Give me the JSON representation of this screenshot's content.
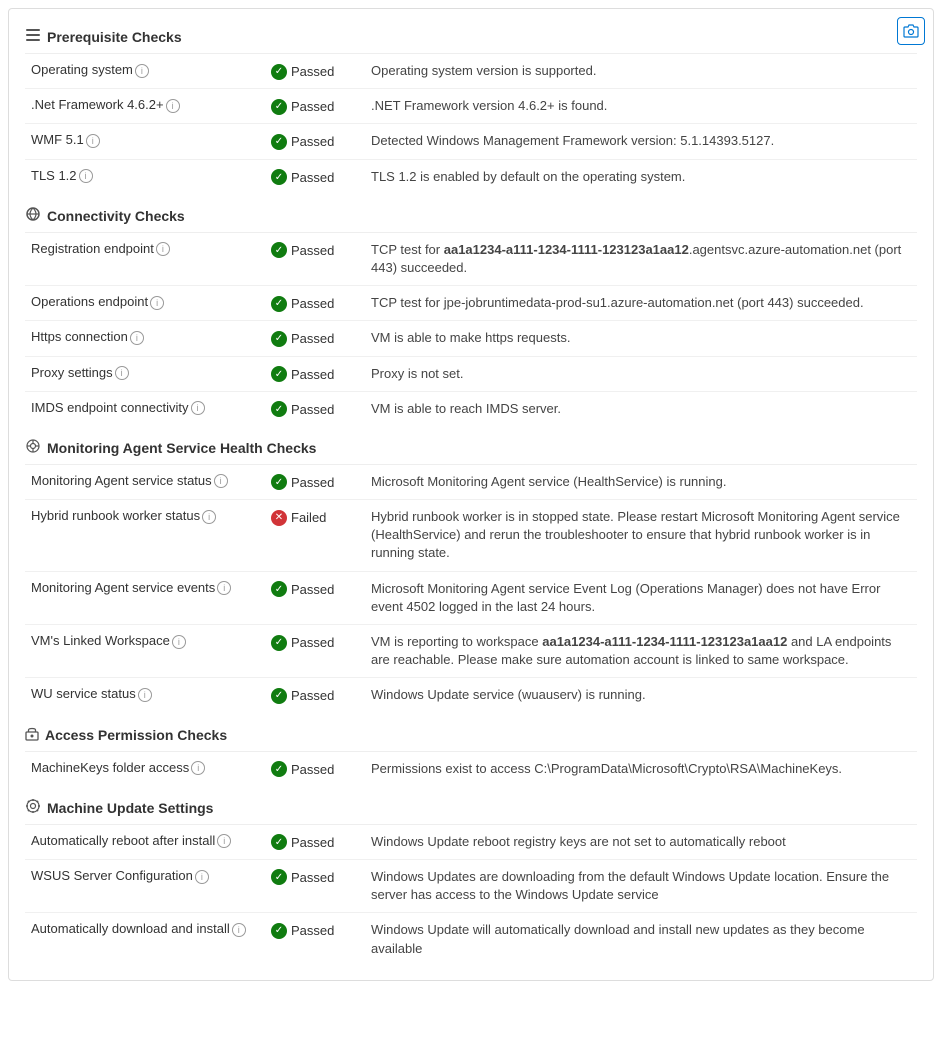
{
  "title": "Prerequisite Checks",
  "camera_button_label": "📷",
  "sections": [
    {
      "id": "prerequisite",
      "icon": "≡",
      "icon_name": "list-icon",
      "label": "Prerequisite Checks",
      "rows": [
        {
          "name": "Operating system",
          "has_info": true,
          "status": "Passed",
          "status_type": "passed",
          "description": "Operating system version is supported."
        },
        {
          "name": ".Net Framework 4.6.2+",
          "has_info": true,
          "status": "Passed",
          "status_type": "passed",
          "description": ".NET Framework version 4.6.2+ is found."
        },
        {
          "name": "WMF 5.1",
          "has_info": true,
          "status": "Passed",
          "status_type": "passed",
          "description": "Detected Windows Management Framework version: 5.1.14393.5127."
        },
        {
          "name": "TLS 1.2",
          "has_info": true,
          "status": "Passed",
          "status_type": "passed",
          "description": "TLS 1.2 is enabled by default on the operating system."
        }
      ]
    },
    {
      "id": "connectivity",
      "icon": "↺",
      "icon_name": "connectivity-icon",
      "label": "Connectivity Checks",
      "rows": [
        {
          "name": "Registration endpoint",
          "has_info": true,
          "status": "Passed",
          "status_type": "passed",
          "description": "TCP test for aa1a1234-a111-1234-1111-123123a1aa12.agentsvc.azure-automation.net (port 443) succeeded.",
          "bold_parts": [
            "aa1a1234-a111-1234-1111-123123a1aa12"
          ]
        },
        {
          "name": "Operations endpoint",
          "has_info": true,
          "status": "Passed",
          "status_type": "passed",
          "description": "TCP test for jpe-jobruntimedata-prod-su1.azure-automation.net (port 443) succeeded."
        },
        {
          "name": "Https connection",
          "has_info": true,
          "status": "Passed",
          "status_type": "passed",
          "description": "VM is able to make https requests."
        },
        {
          "name": "Proxy settings",
          "has_info": true,
          "status": "Passed",
          "status_type": "passed",
          "description": "Proxy is not set."
        },
        {
          "name": "IMDS endpoint connectivity",
          "has_info": true,
          "status": "Passed",
          "status_type": "passed",
          "description": "VM is able to reach IMDS server."
        }
      ]
    },
    {
      "id": "monitoring",
      "icon": "⚙",
      "icon_name": "monitoring-icon",
      "label": "Monitoring Agent Service Health Checks",
      "rows": [
        {
          "name": "Monitoring Agent service status",
          "has_info": true,
          "status": "Passed",
          "status_type": "passed",
          "description": "Microsoft Monitoring Agent service (HealthService) is running."
        },
        {
          "name": "Hybrid runbook worker status",
          "has_info": true,
          "status": "Failed",
          "status_type": "failed",
          "description": "Hybrid runbook worker is in stopped state. Please restart Microsoft Monitoring Agent service (HealthService) and rerun the troubleshooter to ensure that hybrid runbook worker is in running state."
        },
        {
          "name": "Monitoring Agent service events",
          "has_info": true,
          "status": "Passed",
          "status_type": "passed",
          "description": "Microsoft Monitoring Agent service Event Log (Operations Manager) does not have Error event 4502 logged in the last 24 hours."
        },
        {
          "name": "VM's Linked Workspace",
          "has_info": true,
          "status": "Passed",
          "status_type": "passed",
          "description": "VM is reporting to workspace aa1a1234-a111-1234-1111-123123a1aa12 and LA endpoints are reachable. Please make sure automation account is linked to same workspace.",
          "bold_parts": [
            "aa1a1234-a111-1234-1111-123123a1aa12"
          ]
        },
        {
          "name": "WU service status",
          "has_info": true,
          "status": "Passed",
          "status_type": "passed",
          "description": "Windows Update service (wuauserv) is running."
        }
      ]
    },
    {
      "id": "access",
      "icon": "🔒",
      "icon_name": "lock-icon",
      "label": "Access Permission Checks",
      "rows": [
        {
          "name": "MachineKeys folder access",
          "has_info": true,
          "status": "Passed",
          "status_type": "passed",
          "description": "Permissions exist to access C:\\ProgramData\\Microsoft\\Crypto\\RSA\\MachineKeys."
        }
      ]
    },
    {
      "id": "machine-update",
      "icon": "⚙",
      "icon_name": "settings-icon",
      "label": "Machine Update Settings",
      "rows": [
        {
          "name": "Automatically reboot after install",
          "has_info": true,
          "status": "Passed",
          "status_type": "passed",
          "description": "Windows Update reboot registry keys are not set to automatically reboot"
        },
        {
          "name": "WSUS Server Configuration",
          "has_info": true,
          "status": "Passed",
          "status_type": "passed",
          "description": "Windows Updates are downloading from the default Windows Update location. Ensure the server has access to the Windows Update service"
        },
        {
          "name": "Automatically download and install",
          "has_info": true,
          "status": "Passed",
          "status_type": "passed",
          "description": "Windows Update will automatically download and install new updates as they become available"
        }
      ]
    }
  ]
}
